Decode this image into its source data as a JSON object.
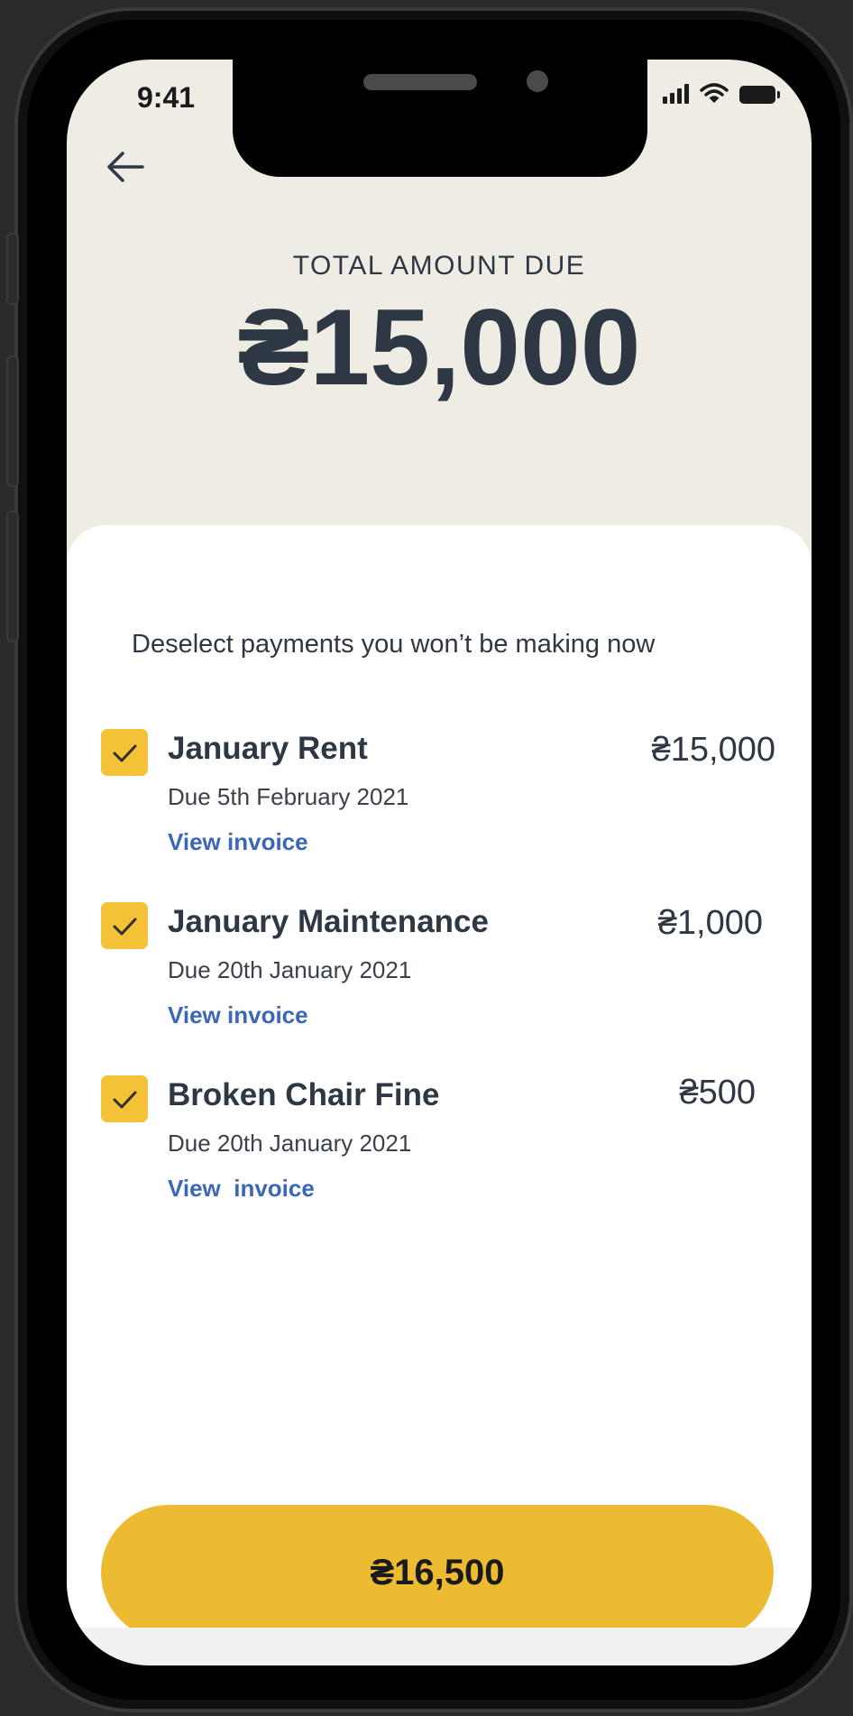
{
  "status_bar": {
    "time": "9:41",
    "icons": [
      "signal-icon",
      "wifi-icon",
      "battery-icon"
    ]
  },
  "header": {
    "back_icon": "arrow-left-icon",
    "total_label": "TOTAL AMOUNT DUE",
    "total_value": "₴15,000"
  },
  "payments": {
    "instruction": "Deselect payments you won’t be making now",
    "items": [
      {
        "checked": true,
        "title": "January Rent",
        "due": "Due 5th February 2021",
        "link": "View invoice",
        "amount": "₴15,000"
      },
      {
        "checked": true,
        "title": "January Maintenance",
        "due": "Due 20th January 2021",
        "link": "View invoice",
        "amount": "₴1,000"
      },
      {
        "checked": true,
        "title": "Broken Chair Fine",
        "due": "Due 20th January 2021",
        "link": "View  invoice",
        "amount": "₴500"
      }
    ]
  },
  "pay_button": {
    "label": "₴16,500"
  },
  "colors": {
    "accent": "#ECBB31",
    "checkbox": "#F4C237",
    "link": "#3B67B5",
    "text": "#2E3744",
    "header_bg": "#EFECE4"
  }
}
